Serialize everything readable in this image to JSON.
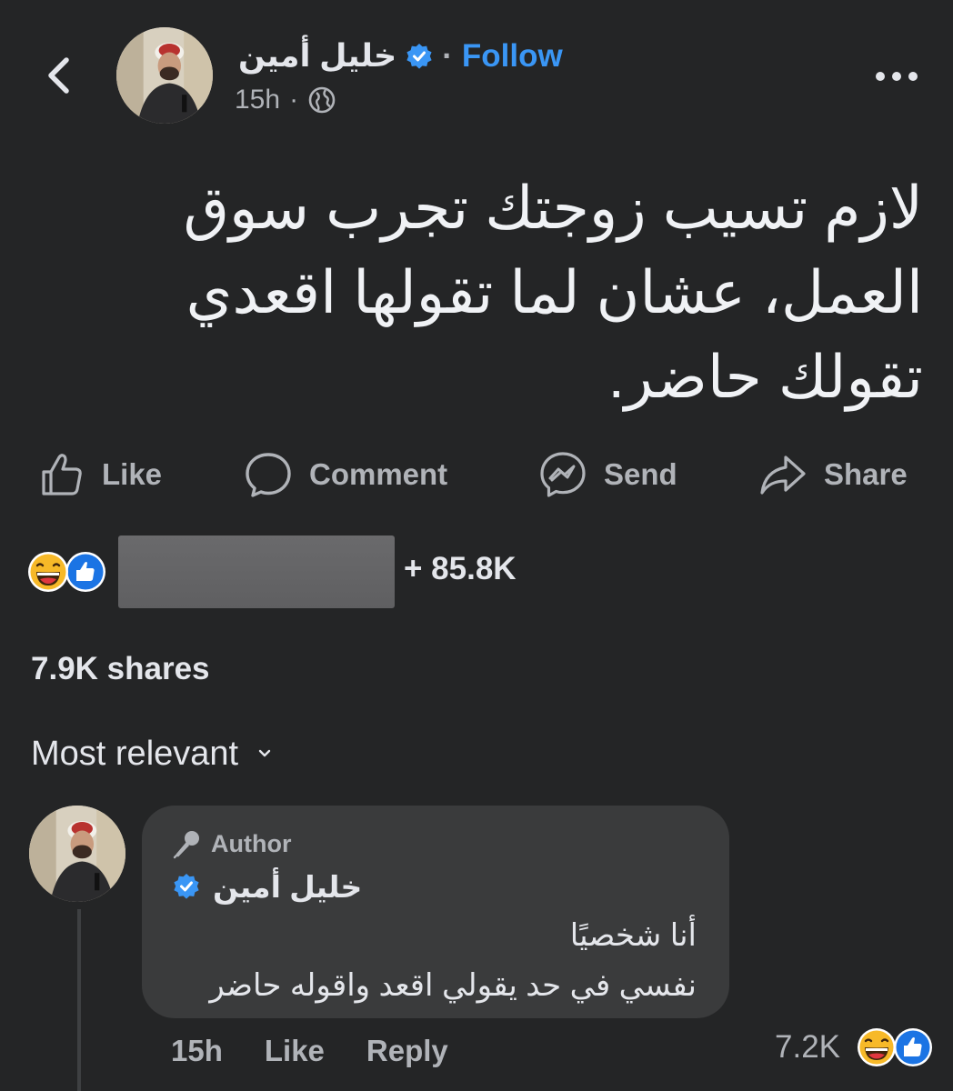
{
  "header": {
    "author_name": "خليل  أمين",
    "follow_label": "Follow",
    "separator": "·",
    "time": "15h",
    "meta_separator": "·"
  },
  "post": {
    "text_lines": [
      "لازم تسيب زوجتك تجرب سوق",
      "العمل، عشان لما تقولها اقعدي",
      "تقولك حاضر."
    ]
  },
  "actions": {
    "like": "Like",
    "comment": "Comment",
    "send": "Send",
    "share": "Share"
  },
  "reactions": {
    "count": "+ 85.8K",
    "types": [
      "haha-icon",
      "like-icon"
    ]
  },
  "shares": "7.9K shares",
  "sort": {
    "label": "Most relevant"
  },
  "comment": {
    "badge": "Author",
    "author_name": "خليل  أمين",
    "text_lines": [
      "أنا شخصيًا",
      "نفسي في حد يقولي اقعد واقوله حاضر"
    ],
    "time": "15h",
    "like_label": "Like",
    "reply_label": "Reply",
    "reaction_count": "7.2K"
  },
  "colors": {
    "background": "#242526",
    "accent": "#3a96f5",
    "bubble": "#3a3b3c",
    "muted_text": "#b0b3b8"
  }
}
